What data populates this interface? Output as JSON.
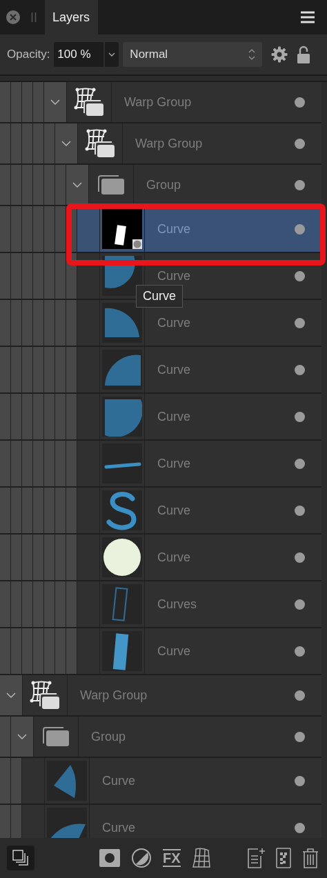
{
  "tab": {
    "label": "Layers",
    "selected": true
  },
  "opacity": {
    "label": "Opacity:",
    "value": "100 %"
  },
  "blend_mode": {
    "value": "Normal"
  },
  "layers": [
    {
      "children": [
        {
          "children": [
            {
              "children": [
                {
                  "children": [
                    {
                      "name": "Warp Group",
                      "kind": "warp",
                      "expanded": true,
                      "selected": false,
                      "children": [
                        {
                          "name": "Warp Group",
                          "kind": "warp",
                          "expanded": true,
                          "selected": false,
                          "children": [
                            {
                              "name": "Group",
                              "kind": "group",
                              "expanded": true,
                              "selected": false,
                              "children": [
                                {
                                  "name": "Curve",
                                  "kind": "curve",
                                  "thumbnail": {
                                    "kind": "mask-rect"
                                  },
                                  "selected": true
                                },
                                {
                                  "name": "Curve",
                                  "kind": "curve",
                                  "thumbnail": {
                                    "kind": "half-disc"
                                  },
                                  "selected": false
                                },
                                {
                                  "name": "Curve",
                                  "kind": "curve",
                                  "thumbnail": {
                                    "kind": "quarter-disc"
                                  },
                                  "selected": false
                                },
                                {
                                  "name": "Curve",
                                  "kind": "curve",
                                  "thumbnail": {
                                    "kind": "quarter-disc-top"
                                  },
                                  "selected": false
                                },
                                {
                                  "name": "Curve",
                                  "kind": "curve",
                                  "thumbnail": {
                                    "kind": "half-disc-bottom"
                                  },
                                  "selected": false
                                },
                                {
                                  "name": "Curve",
                                  "kind": "curve",
                                  "thumbnail": {
                                    "kind": "stroke"
                                  },
                                  "selected": false
                                },
                                {
                                  "name": "Curve",
                                  "kind": "curve",
                                  "thumbnail": {
                                    "kind": "s-shape"
                                  },
                                  "selected": false
                                },
                                {
                                  "name": "Curve",
                                  "kind": "curve",
                                  "thumbnail": {
                                    "kind": "disc"
                                  },
                                  "selected": false
                                },
                                {
                                  "name": "Curves",
                                  "kind": "curve",
                                  "thumbnail": {
                                    "kind": "outline-rect"
                                  },
                                  "selected": false
                                },
                                {
                                  "name": "Curve",
                                  "kind": "curve",
                                  "thumbnail": {
                                    "kind": "blue-rect"
                                  },
                                  "selected": false
                                }
                              ]
                            }
                          ]
                        }
                      ]
                    }
                  ]
                }
              ]
            }
          ]
        }
      ]
    },
    {
      "name": "Warp Group",
      "kind": "warp",
      "expanded": true,
      "selected": false,
      "children": [
        {
          "name": "Group",
          "kind": "group",
          "expanded": true,
          "selected": false,
          "children": [
            {
              "name": "Curve",
              "kind": "curve",
              "thumbnail": {
                "kind": "wedge"
              },
              "selected": false
            },
            {
              "name": "Curve",
              "kind": "curve",
              "thumbnail": {
                "kind": "wedge-flat"
              },
              "selected": false
            }
          ]
        }
      ]
    }
  ],
  "tooltip": "Curve",
  "bottom_toolbar": [
    {
      "kind": "arrange",
      "selected": true
    },
    {
      "kind": "mask",
      "selected": false
    },
    {
      "kind": "adjustment",
      "selected": false
    },
    {
      "kind": "fx",
      "label": "FX",
      "selected": false
    },
    {
      "kind": "warp",
      "selected": false
    },
    {
      "kind": "add-layer",
      "selected": false
    },
    {
      "kind": "pixel-layer",
      "selected": false
    },
    {
      "kind": "delete",
      "selected": false
    }
  ]
}
